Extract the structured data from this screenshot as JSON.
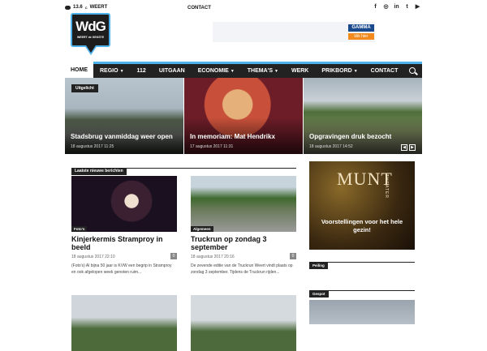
{
  "topbar": {
    "temperature": "13.6",
    "unit": "C",
    "city": "WEERT",
    "contact": "CONTACT",
    "social_icons": [
      "facebook-icon",
      "instagram-icon",
      "linkedin-icon",
      "twitter-icon",
      "youtube-icon"
    ]
  },
  "logo": {
    "big": "WdG",
    "small": "WEERT de GEKSTE"
  },
  "banner": {
    "brand": "GAMMA",
    "cta": "klik hier"
  },
  "nav": {
    "items": [
      {
        "label": "HOME",
        "dropdown": false
      },
      {
        "label": "REGIO",
        "dropdown": true
      },
      {
        "label": "112",
        "dropdown": false
      },
      {
        "label": "UITGAAN",
        "dropdown": false
      },
      {
        "label": "ECONOMIE",
        "dropdown": true
      },
      {
        "label": "THEMA'S",
        "dropdown": true
      },
      {
        "label": "WERK",
        "dropdown": false
      },
      {
        "label": "PRIKBORD",
        "dropdown": true
      },
      {
        "label": "CONTACT",
        "dropdown": false
      }
    ]
  },
  "slider": {
    "tag": "Uitgelicht",
    "slides": [
      {
        "title": "Stadsbrug vanmiddag weer open",
        "date": "18 augustus 2017 11:25"
      },
      {
        "title": "In memoriam: Mat Hendrikx",
        "date": "17 augustus 2017 11:31"
      },
      {
        "title": "Opgravingen druk bezocht",
        "date": "18 augustus 2017 14:52"
      }
    ]
  },
  "section": {
    "title": "Laatste nieuwe berichten"
  },
  "articles": [
    {
      "tag": "Foto's",
      "title": "Kinjerkermis Stramproy in beeld",
      "date": "18 augustus 2017 22:10",
      "comments": "0",
      "excerpt": "(Foto's) Al bijna 50 jaar is KVW een begrip in Stramproy en ook afgelopen week genoten ruim..."
    },
    {
      "tag": "Algemeen",
      "title": "Truckrun op zondag 3 september",
      "date": "18 augustus 2017 20:16",
      "comments": "0",
      "excerpt": "De zevende editie van de Truckrun Weert vindt plaats op zondag 3 september. Tijdens de Truckrun rijden..."
    }
  ],
  "ad": {
    "brand": "MUNT",
    "subtitle": "THEATER",
    "slogan": "Voorstellingen voor het hele gezin!"
  },
  "sidebar": {
    "poll": "Peiling",
    "spotted": "Gespot"
  }
}
